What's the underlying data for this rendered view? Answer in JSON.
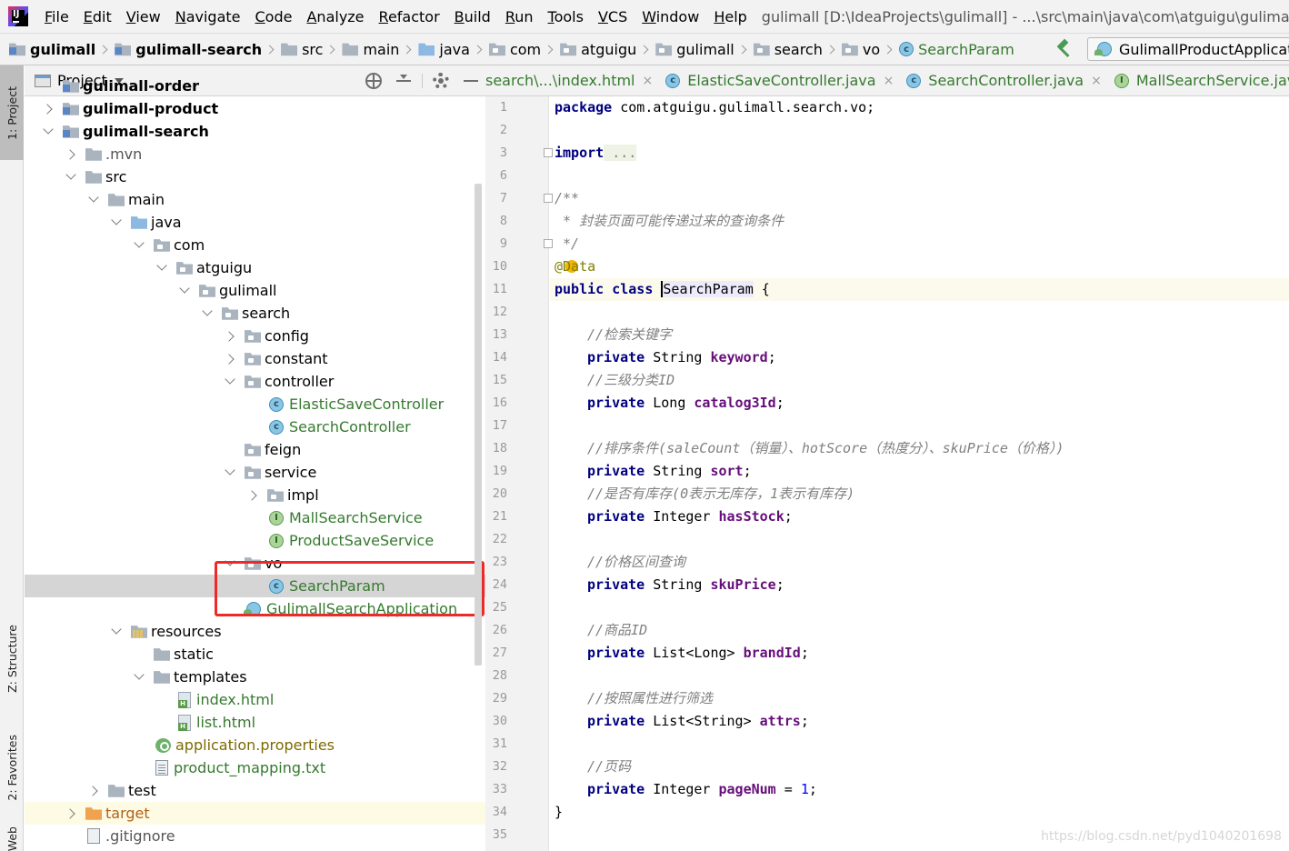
{
  "menubar": {
    "items": [
      "File",
      "Edit",
      "View",
      "Navigate",
      "Code",
      "Analyze",
      "Refactor",
      "Build",
      "Run",
      "Tools",
      "VCS",
      "Window",
      "Help"
    ],
    "window_title": "gulimall [D:\\IdeaProjects\\gulimall] - ...\\src\\main\\java\\com\\atguigu\\gulimall\\search\\vo\\S"
  },
  "breadcrumb": [
    "gulimall",
    "gulimall-search",
    "src",
    "main",
    "java",
    "com",
    "atguigu",
    "gulimall",
    "search",
    "vo",
    "SearchParam"
  ],
  "run_config": "GulimallProductApplication",
  "left_strip": {
    "project": "1: Project",
    "structure": "Z: Structure",
    "favorites": "2: Favorites",
    "web": "Web"
  },
  "project_panel": {
    "title": "Project",
    "tree": [
      {
        "name": "gulimall-order",
        "icon": "module",
        "arrow": "none",
        "style": "bold",
        "indent": 0
      },
      {
        "name": "gulimall-product",
        "icon": "module",
        "arrow": "right",
        "style": "bold",
        "indent": 0
      },
      {
        "name": "gulimall-search",
        "icon": "module",
        "arrow": "down",
        "style": "bold",
        "indent": 0
      },
      {
        "name": ".mvn",
        "icon": "folder",
        "arrow": "right",
        "style": "muted",
        "indent": 1
      },
      {
        "name": "src",
        "icon": "folder",
        "arrow": "down",
        "style": "normal",
        "indent": 1
      },
      {
        "name": "main",
        "icon": "folder",
        "arrow": "down",
        "style": "normal",
        "indent": 2
      },
      {
        "name": "java",
        "icon": "folder-blue",
        "arrow": "down",
        "style": "normal",
        "indent": 3
      },
      {
        "name": "com",
        "icon": "folder-pkg",
        "arrow": "down",
        "style": "normal",
        "indent": 4
      },
      {
        "name": "atguigu",
        "icon": "folder-pkg",
        "arrow": "down",
        "style": "normal",
        "indent": 5
      },
      {
        "name": "gulimall",
        "icon": "folder-pkg",
        "arrow": "down",
        "style": "normal",
        "indent": 6
      },
      {
        "name": "search",
        "icon": "folder-pkg",
        "arrow": "down",
        "style": "normal",
        "indent": 7
      },
      {
        "name": "config",
        "icon": "folder-pkg",
        "arrow": "right",
        "style": "normal",
        "indent": 8
      },
      {
        "name": "constant",
        "icon": "folder-pkg",
        "arrow": "right",
        "style": "normal",
        "indent": 8
      },
      {
        "name": "controller",
        "icon": "folder-pkg",
        "arrow": "down",
        "style": "normal",
        "indent": 8
      },
      {
        "name": "ElasticSaveController",
        "icon": "cls",
        "arrow": "none",
        "style": "green",
        "indent": 9
      },
      {
        "name": "SearchController",
        "icon": "cls",
        "arrow": "none",
        "style": "green",
        "indent": 9
      },
      {
        "name": "feign",
        "icon": "folder-pkg",
        "arrow": "none",
        "style": "normal",
        "indent": 8
      },
      {
        "name": "service",
        "icon": "folder-pkg",
        "arrow": "down",
        "style": "normal",
        "indent": 8
      },
      {
        "name": "impl",
        "icon": "folder-pkg",
        "arrow": "right",
        "style": "normal",
        "indent": 9
      },
      {
        "name": "MallSearchService",
        "icon": "iface",
        "arrow": "none",
        "style": "green",
        "indent": 9
      },
      {
        "name": "ProductSaveService",
        "icon": "iface",
        "arrow": "none",
        "style": "green",
        "indent": 9
      },
      {
        "name": "vo",
        "icon": "folder-pkg",
        "arrow": "down",
        "style": "normal",
        "indent": 8
      },
      {
        "name": "SearchParam",
        "icon": "cls",
        "arrow": "none",
        "style": "green",
        "indent": 9,
        "selected": true
      },
      {
        "name": "GulimallSearchApplication",
        "icon": "app-cls",
        "arrow": "none",
        "style": "green",
        "indent": 8
      },
      {
        "name": "resources",
        "icon": "folder-res",
        "arrow": "down",
        "style": "normal",
        "indent": 3
      },
      {
        "name": "static",
        "icon": "folder",
        "arrow": "none",
        "style": "normal",
        "indent": 4
      },
      {
        "name": "templates",
        "icon": "folder",
        "arrow": "down",
        "style": "normal",
        "indent": 4
      },
      {
        "name": "index.html",
        "icon": "html",
        "arrow": "none",
        "style": "green",
        "indent": 5
      },
      {
        "name": "list.html",
        "icon": "html",
        "arrow": "none",
        "style": "green",
        "indent": 5
      },
      {
        "name": "application.properties",
        "icon": "props",
        "arrow": "none",
        "style": "olive",
        "indent": 4
      },
      {
        "name": "product_mapping.txt",
        "icon": "txt",
        "arrow": "none",
        "style": "green",
        "indent": 4
      },
      {
        "name": "test",
        "icon": "folder",
        "arrow": "right",
        "style": "normal",
        "indent": 2
      },
      {
        "name": "target",
        "icon": "folder-orange",
        "arrow": "right",
        "style": "orange",
        "indent": 1,
        "highlight": true
      },
      {
        "name": ".gitignore",
        "icon": "gitfile",
        "arrow": "none",
        "style": "muted",
        "indent": 1
      }
    ]
  },
  "editor": {
    "tabs": [
      {
        "label": "search\\...\\index.html",
        "icon": "h"
      },
      {
        "label": "ElasticSaveController.java",
        "icon": "c"
      },
      {
        "label": "SearchController.java",
        "icon": "c"
      },
      {
        "label": "MallSearchService.java",
        "icon": "i"
      }
    ],
    "line_numbers": [
      "1",
      "2",
      "3",
      "6",
      "7",
      "8",
      "9",
      "10",
      "11",
      "12",
      "13",
      "14",
      "15",
      "16",
      "17",
      "18",
      "19",
      "20",
      "21",
      "22",
      "23",
      "24",
      "25",
      "26",
      "27",
      "28",
      "29",
      "30",
      "31",
      "32",
      "33",
      "34",
      "35"
    ],
    "code": {
      "l1_kw": "package",
      "l1_rest": " com.atguigu.gulimall.search.vo;",
      "l3_kw": "import",
      "l3_rest": " ...",
      "l7": "/**",
      "l8": " * 封装页面可能传递过来的查询条件",
      "l9": " */",
      "l10_a": "@",
      "l10_b": "Data",
      "l11_kw": "public class ",
      "l11_cls": "SearchParam",
      "l11_rest": " {",
      "c_keyword": "//检索关键字",
      "kw_private": "private",
      "t_string": " String ",
      "f_keyword": "keyword",
      "semi": ";",
      "c_catalog": "//三级分类ID",
      "t_long": " Long ",
      "f_catalog": "catalog3Id",
      "c_sort": "//排序条件(saleCount（销量）、hotScore（热度分）、skuPrice（价格）)",
      "f_sort": "sort",
      "c_stock": "//是否有库存(0表示无库存，1表示有库存)",
      "t_integer": " Integer ",
      "f_stock": "hasStock",
      "c_price": "//价格区间查询",
      "f_price": "skuPrice",
      "c_brand": "//商品ID",
      "t_list_long": " List<Long> ",
      "f_brand": "brandId",
      "c_attrs": "//按照属性进行筛选",
      "t_list_string": " List<String> ",
      "f_attrs": "attrs",
      "c_page": "//页码",
      "f_page": "pageNum",
      "eq": " = ",
      "n_one": "1",
      "close_brace": "}"
    }
  },
  "watermark": "https://blog.csdn.net/pyd1040201698"
}
